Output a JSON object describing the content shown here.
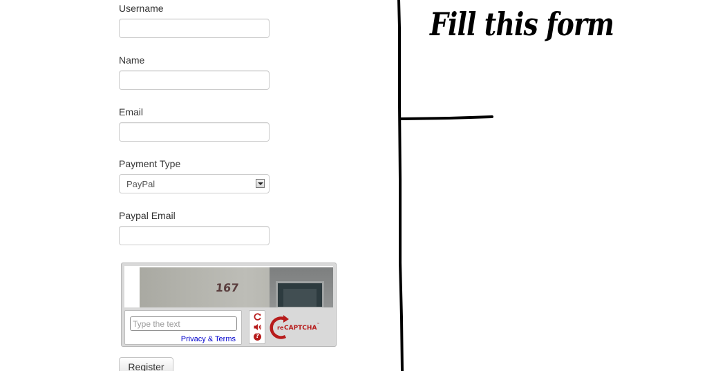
{
  "form": {
    "username_label": "Username",
    "username_value": "",
    "name_label": "Name",
    "name_value": "",
    "email_label": "Email",
    "email_value": "",
    "payment_type_label": "Payment Type",
    "payment_type_selected": "PayPal",
    "paypal_email_label": "Paypal Email",
    "paypal_email_value": "",
    "register_label": "Register"
  },
  "captcha": {
    "image_number": "167",
    "input_placeholder": "Type the text",
    "privacy_label": "Privacy & Terms",
    "refresh_icon": "refresh-icon",
    "audio_icon": "audio-icon",
    "help_icon": "help-icon",
    "help_glyph": "?",
    "logo_re": "re",
    "logo_text": "CAPTCHA",
    "logo_tm": "™",
    "accent_color": "#b71c1c"
  },
  "annotation": {
    "heading": "Fill this form"
  }
}
